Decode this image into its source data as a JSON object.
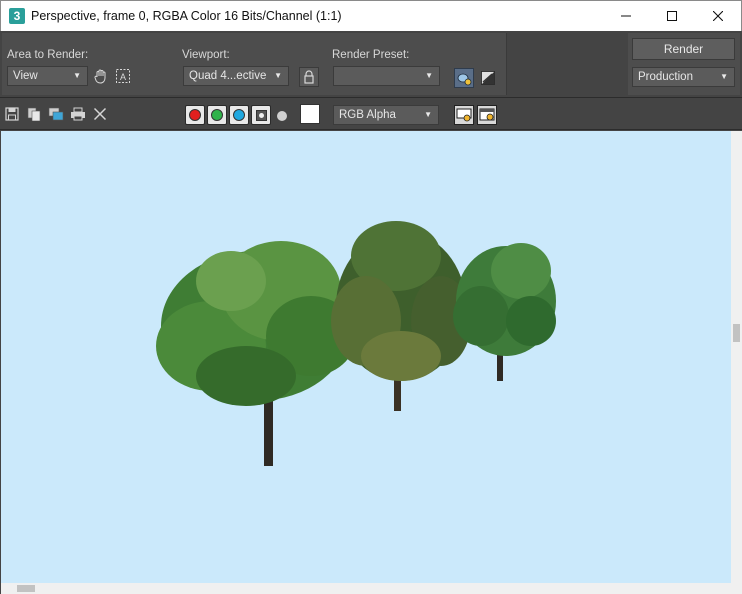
{
  "window": {
    "title": "Perspective, frame 0, RGBA Color 16 Bits/Channel (1:1)",
    "app_icon_text": "3"
  },
  "controls": {
    "area_to_render": {
      "label": "Area to Render:",
      "value": "View"
    },
    "viewport": {
      "label": "Viewport:",
      "value": "Quad 4...ective"
    },
    "render_preset": {
      "label": "Render Preset:",
      "value": ""
    },
    "render_button": "Render",
    "render_mode": {
      "value": "Production"
    }
  },
  "toolbar": {
    "channel_display": {
      "value": "RGB Alpha"
    },
    "channels": [
      {
        "name": "red",
        "color": "#e0201f",
        "active": true
      },
      {
        "name": "green",
        "color": "#2fb34a",
        "active": true
      },
      {
        "name": "blue",
        "color": "#1fa8e0",
        "active": true
      },
      {
        "name": "alpha",
        "color": "#555555",
        "active": true
      }
    ],
    "background_swatch_color": "#ffffff"
  },
  "viewport": {
    "background_color": "#cbe9fb"
  },
  "colors": {
    "ui_dark": "#444444",
    "panel": "#4d4d4d",
    "dropdown": "#5b5b5b",
    "text_light": "#d8d8d8"
  }
}
